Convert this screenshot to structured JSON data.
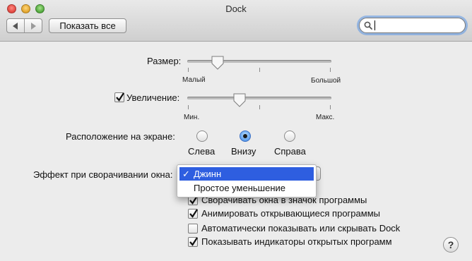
{
  "window": {
    "title": "Dock"
  },
  "toolbar": {
    "show_all_label": "Показать все",
    "search_value": ""
  },
  "size": {
    "label": "Размер:",
    "min_label": "Малый",
    "max_label": "Большой",
    "value_fraction": 0.2
  },
  "magnification": {
    "label": "Увеличение:",
    "checked": true,
    "min_label": "Мин.",
    "max_label": "Макс.",
    "value_fraction": 0.35
  },
  "position": {
    "label": "Расположение на экране:",
    "options": [
      {
        "label": "Слева",
        "selected": false
      },
      {
        "label": "Внизу",
        "selected": true
      },
      {
        "label": "Справа",
        "selected": false
      }
    ]
  },
  "minimize_effect": {
    "label": "Эффект при сворачивании окна:",
    "options": [
      {
        "label": "Джинн",
        "selected": true,
        "check": "✓"
      },
      {
        "label": "Простое уменьшение",
        "selected": false
      }
    ]
  },
  "checkboxes": [
    {
      "label": "Сворачивать окна в значок программы",
      "checked": true
    },
    {
      "label": "Анимировать открывающиеся программы",
      "checked": true
    },
    {
      "label": "Автоматически показывать или скрывать Dock",
      "checked": false
    },
    {
      "label": "Показывать индикаторы открытых программ",
      "checked": true
    }
  ],
  "help": {
    "label": "?"
  },
  "colors": {
    "accent": "#2e5ee0",
    "background": "#ececec"
  }
}
